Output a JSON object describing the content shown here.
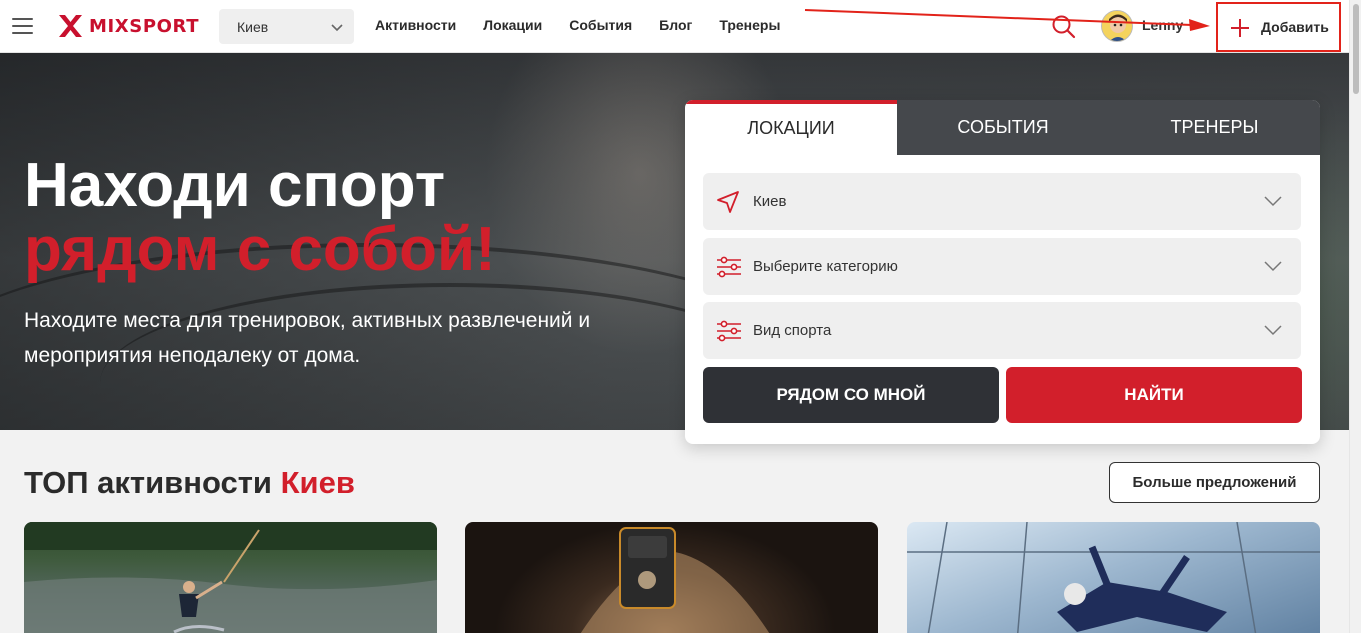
{
  "header": {
    "logo_text": "MIXSPORT",
    "city_select": {
      "value": "Киев"
    },
    "nav": [
      "Активности",
      "Локации",
      "События",
      "Блог",
      "Тренеры"
    ],
    "user": {
      "name": "Lenny"
    },
    "add_button_label": "Добавить"
  },
  "hero": {
    "title_line1": "Находи спорт",
    "title_line2": "рядом с собой!",
    "subtitle": "Находите места для тренировок, активных развлечений и мероприятия неподалеку от дома."
  },
  "search_card": {
    "tabs": [
      "ЛОКАЦИИ",
      "СОБЫТИЯ",
      "ТРЕНЕРЫ"
    ],
    "active_tab": "ЛОКАЦИИ",
    "fields": [
      {
        "icon": "location-arrow-icon",
        "text": "Киев"
      },
      {
        "icon": "filter-sliders-icon",
        "text": "Выберите категорию"
      },
      {
        "icon": "filter-sliders-icon",
        "text": "Вид спорта"
      }
    ],
    "near_me_label": "РЯДОМ СО МНОЙ",
    "find_label": "НАЙТИ"
  },
  "top_section": {
    "title": "ТОП активности",
    "city": "Киев",
    "more_label": "Больше предложений"
  },
  "colors": {
    "accent_red": "#d21f2b",
    "dark_button": "#2f3136",
    "annotation_red": "#e2231a"
  }
}
